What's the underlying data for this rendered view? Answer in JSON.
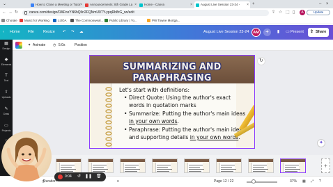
{
  "browser": {
    "tabs": [
      {
        "label": "How to Close a Meeting or Tutor",
        "fav": "#3b82f6"
      },
      {
        "label": "Announcements: 8th Grade La",
        "fav": "#e53935"
      },
      {
        "label": "Home - Canva",
        "fav": "#00c4cc"
      },
      {
        "label": "August Live Session 23-24 - ",
        "fav": "#00c4cc",
        "active": true
      }
    ],
    "url": "canva.com/design/DAFnoYN6hQl/n2FQNmU0TY-ypqRb8rG_rw/edit",
    "update_label": "Update",
    "profile_initial": "A"
  },
  "bookmarks": [
    {
      "label": "Chorale",
      "fav": "#888"
    },
    {
      "label": "Music for Working",
      "fav": "#e53935"
    },
    {
      "label": "LIJOA",
      "fav": "#1565c0"
    },
    {
      "label": "The Commonweal...",
      "fav": "#555"
    },
    {
      "label": "Public Library | Yo...",
      "fav": "#2e7d32"
    },
    {
      "label": "PW Towne Mortga...",
      "fav": "#f9a825"
    }
  ],
  "canva": {
    "home": "Home",
    "file": "File",
    "resize": "Resize",
    "doc_title": "August Live Session 23-24",
    "collab_initials": "AM",
    "present": "Present",
    "share": "Share"
  },
  "side_panel": [
    {
      "label": "Design",
      "icon": "grid-icon",
      "glyph": "▦"
    },
    {
      "label": "Elements",
      "icon": "shapes-icon",
      "glyph": "◆"
    },
    {
      "label": "Text",
      "icon": "text-icon",
      "glyph": "T"
    },
    {
      "label": "Uploads",
      "icon": "upload-icon",
      "glyph": "⇧"
    },
    {
      "label": "Draw",
      "icon": "pen-icon",
      "glyph": "✎"
    },
    {
      "label": "Projects",
      "icon": "folder-icon",
      "glyph": "▭"
    },
    {
      "label": "Apps",
      "icon": "apps-icon",
      "glyph": "⁘"
    }
  ],
  "toolbar": {
    "animate": "Animate",
    "duration": "5.0s",
    "position": "Position"
  },
  "slide": {
    "title": "SUMMARIZING AND PARAPHRASING",
    "intro": "Let's start with definitions:",
    "lines": [
      {
        "pre": "Direct Quote: Using the author's exact",
        "u": "",
        "post": "",
        "bullet": true
      },
      {
        "pre": "words in quotation marks",
        "u": "",
        "post": "",
        "bullet": false
      },
      {
        "pre": "Summarize: Putting the author's main ideas",
        "u": "",
        "post": "",
        "bullet": true
      },
      {
        "pre": "",
        "u": "in your own words",
        "post": ".",
        "bullet": false
      },
      {
        "pre": "Paraphrase: Putting the author's main ideas",
        "u": "",
        "post": "",
        "bullet": true
      },
      {
        "pre": "and supporting details ",
        "u": "in your own words",
        "post": ".",
        "bullet": false
      }
    ]
  },
  "bottom": {
    "recording_time": "0:04",
    "duration_label": "Duration",
    "page_indicator": "Page 12 / 22",
    "zoom": "37%"
  }
}
